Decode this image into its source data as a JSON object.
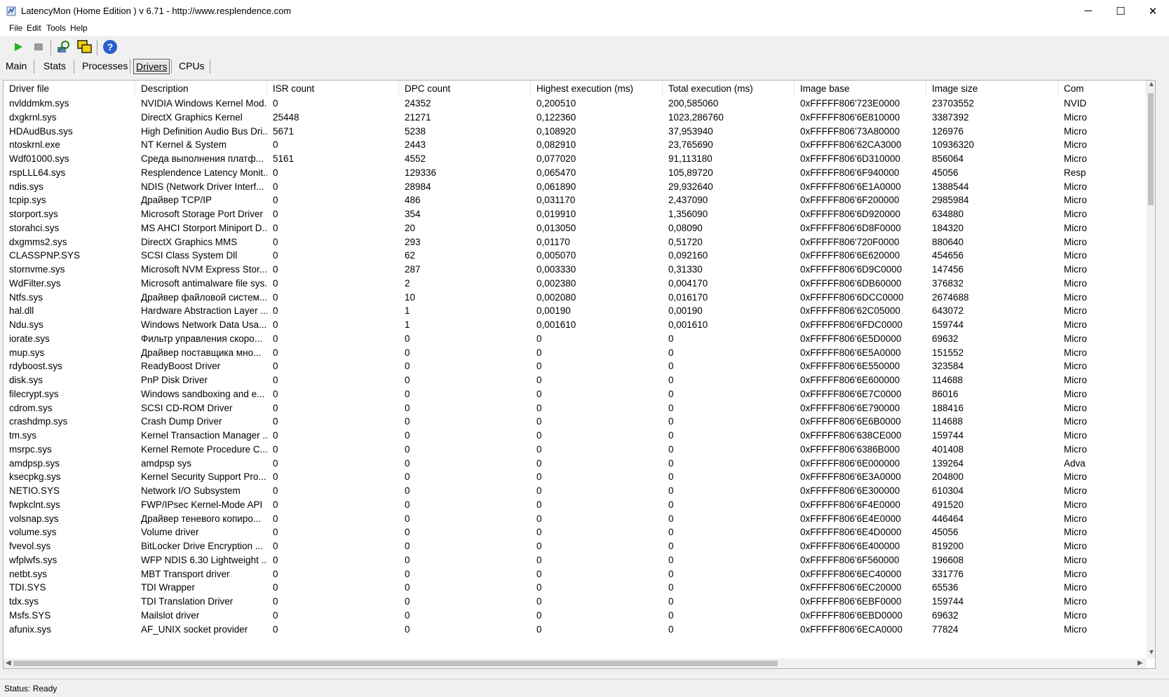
{
  "window": {
    "title": "LatencyMon  (Home Edition )  v 6.71 - http://www.resplendence.com",
    "minimize_glyph": "─",
    "maximize_glyph": "☐",
    "close_glyph": "✕"
  },
  "menu": [
    "File",
    "Edit",
    "Tools",
    "Help"
  ],
  "toolbar": {
    "buttons": [
      "play-icon",
      "stop-icon",
      "search-icon",
      "windows-icon",
      "help-icon"
    ]
  },
  "tabs": [
    {
      "label": "Main"
    },
    {
      "label": "Stats"
    },
    {
      "label": "Processes"
    },
    {
      "label": "Drivers",
      "active": true
    },
    {
      "label": "CPUs"
    }
  ],
  "table": {
    "columns": [
      "Driver file",
      "Description",
      "ISR count",
      "DPC count",
      "Highest execution (ms)",
      "Total execution (ms)",
      "Image base",
      "Image size",
      "Com"
    ],
    "rows": [
      [
        "nvlddmkm.sys",
        "NVIDIA Windows Kernel Mod...",
        "0",
        "24352",
        "0,200510",
        "200,585060",
        "0xFFFFF806'723E0000",
        "23703552",
        "NVID"
      ],
      [
        "dxgkrnl.sys",
        "DirectX Graphics Kernel",
        "25448",
        "21271",
        "0,122360",
        "1023,286760",
        "0xFFFFF806'6E810000",
        "3387392",
        "Micro"
      ],
      [
        "HDAudBus.sys",
        "High Definition Audio Bus Dri...",
        "5671",
        "5238",
        "0,108920",
        "37,953940",
        "0xFFFFF806'73A80000",
        "126976",
        "Micro"
      ],
      [
        "ntoskrnl.exe",
        "NT Kernel & System",
        "0",
        "2443",
        "0,082910",
        "23,765690",
        "0xFFFFF806'62CA3000",
        "10936320",
        "Micro"
      ],
      [
        "Wdf01000.sys",
        "Среда выполнения платф...",
        "5161",
        "4552",
        "0,077020",
        "91,113180",
        "0xFFFFF806'6D310000",
        "856064",
        "Micro"
      ],
      [
        "rspLLL64.sys",
        "Resplendence Latency Monit...",
        "0",
        "129336",
        "0,065470",
        "105,89720",
        "0xFFFFF806'6F940000",
        "45056",
        "Resp"
      ],
      [
        "ndis.sys",
        "NDIS (Network Driver Interf...",
        "0",
        "28984",
        "0,061890",
        "29,932640",
        "0xFFFFF806'6E1A0000",
        "1388544",
        "Micro"
      ],
      [
        "tcpip.sys",
        "Драйвер TCP/IP",
        "0",
        "486",
        "0,031170",
        "2,437090",
        "0xFFFFF806'6F200000",
        "2985984",
        "Micro"
      ],
      [
        "storport.sys",
        "Microsoft Storage Port Driver",
        "0",
        "354",
        "0,019910",
        "1,356090",
        "0xFFFFF806'6D920000",
        "634880",
        "Micro"
      ],
      [
        "storahci.sys",
        "MS AHCI Storport Miniport D...",
        "0",
        "20",
        "0,013050",
        "0,08090",
        "0xFFFFF806'6D8F0000",
        "184320",
        "Micro"
      ],
      [
        "dxgmms2.sys",
        "DirectX Graphics MMS",
        "0",
        "293",
        "0,01170",
        "0,51720",
        "0xFFFFF806'720F0000",
        "880640",
        "Micro"
      ],
      [
        "CLASSPNP.SYS",
        "SCSI Class System Dll",
        "0",
        "62",
        "0,005070",
        "0,092160",
        "0xFFFFF806'6E620000",
        "454656",
        "Micro"
      ],
      [
        "stornvme.sys",
        "Microsoft NVM Express Stor...",
        "0",
        "287",
        "0,003330",
        "0,31330",
        "0xFFFFF806'6D9C0000",
        "147456",
        "Micro"
      ],
      [
        "WdFilter.sys",
        "Microsoft antimalware file sys...",
        "0",
        "2",
        "0,002380",
        "0,004170",
        "0xFFFFF806'6DB60000",
        "376832",
        "Micro"
      ],
      [
        "Ntfs.sys",
        "Драйвер файловой систем...",
        "0",
        "10",
        "0,002080",
        "0,016170",
        "0xFFFFF806'6DCC0000",
        "2674688",
        "Micro"
      ],
      [
        "hal.dll",
        "Hardware Abstraction Layer ...",
        "0",
        "1",
        "0,00190",
        "0,00190",
        "0xFFFFF806'62C05000",
        "643072",
        "Micro"
      ],
      [
        "Ndu.sys",
        "Windows Network Data Usa...",
        "0",
        "1",
        "0,001610",
        "0,001610",
        "0xFFFFF806'6FDC0000",
        "159744",
        "Micro"
      ],
      [
        "iorate.sys",
        "Фильтр управления скоро...",
        "0",
        "0",
        "0",
        "0",
        "0xFFFFF806'6E5D0000",
        "69632",
        "Micro"
      ],
      [
        "mup.sys",
        "Драйвер поставщика мно...",
        "0",
        "0",
        "0",
        "0",
        "0xFFFFF806'6E5A0000",
        "151552",
        "Micro"
      ],
      [
        "rdyboost.sys",
        "ReadyBoost Driver",
        "0",
        "0",
        "0",
        "0",
        "0xFFFFF806'6E550000",
        "323584",
        "Micro"
      ],
      [
        "disk.sys",
        "PnP Disk Driver",
        "0",
        "0",
        "0",
        "0",
        "0xFFFFF806'6E600000",
        "114688",
        "Micro"
      ],
      [
        "filecrypt.sys",
        "Windows sandboxing and e...",
        "0",
        "0",
        "0",
        "0",
        "0xFFFFF806'6E7C0000",
        "86016",
        "Micro"
      ],
      [
        "cdrom.sys",
        "SCSI CD-ROM Driver",
        "0",
        "0",
        "0",
        "0",
        "0xFFFFF806'6E790000",
        "188416",
        "Micro"
      ],
      [
        "crashdmp.sys",
        "Crash Dump Driver",
        "0",
        "0",
        "0",
        "0",
        "0xFFFFF806'6E6B0000",
        "114688",
        "Micro"
      ],
      [
        "tm.sys",
        "Kernel Transaction Manager ...",
        "0",
        "0",
        "0",
        "0",
        "0xFFFFF806'638CE000",
        "159744",
        "Micro"
      ],
      [
        "msrpc.sys",
        "Kernel Remote Procedure C...",
        "0",
        "0",
        "0",
        "0",
        "0xFFFFF806'6386B000",
        "401408",
        "Micro"
      ],
      [
        "amdpsp.sys",
        "amdpsp sys",
        "0",
        "0",
        "0",
        "0",
        "0xFFFFF806'6E000000",
        "139264",
        "Adva"
      ],
      [
        "ksecpkg.sys",
        "Kernel Security Support Pro...",
        "0",
        "0",
        "0",
        "0",
        "0xFFFFF806'6E3A0000",
        "204800",
        "Micro"
      ],
      [
        "NETIO.SYS",
        "Network I/O Subsystem",
        "0",
        "0",
        "0",
        "0",
        "0xFFFFF806'6E300000",
        "610304",
        "Micro"
      ],
      [
        "fwpkclnt.sys",
        "FWP/IPsec Kernel-Mode API",
        "0",
        "0",
        "0",
        "0",
        "0xFFFFF806'6F4E0000",
        "491520",
        "Micro"
      ],
      [
        "volsnap.sys",
        "Драйвер теневого копиро...",
        "0",
        "0",
        "0",
        "0",
        "0xFFFFF806'6E4E0000",
        "446464",
        "Micro"
      ],
      [
        "volume.sys",
        "Volume driver",
        "0",
        "0",
        "0",
        "0",
        "0xFFFFF806'6E4D0000",
        "45056",
        "Micro"
      ],
      [
        "fvevol.sys",
        "BitLocker Drive Encryption ...",
        "0",
        "0",
        "0",
        "0",
        "0xFFFFF806'6E400000",
        "819200",
        "Micro"
      ],
      [
        "wfplwfs.sys",
        "WFP NDIS 6.30 Lightweight ...",
        "0",
        "0",
        "0",
        "0",
        "0xFFFFF806'6F560000",
        "196608",
        "Micro"
      ],
      [
        "netbt.sys",
        "MBT Transport driver",
        "0",
        "0",
        "0",
        "0",
        "0xFFFFF806'6EC40000",
        "331776",
        "Micro"
      ],
      [
        "TDI.SYS",
        "TDI Wrapper",
        "0",
        "0",
        "0",
        "0",
        "0xFFFFF806'6EC20000",
        "65536",
        "Micro"
      ],
      [
        "tdx.sys",
        "TDI Translation Driver",
        "0",
        "0",
        "0",
        "0",
        "0xFFFFF806'6EBF0000",
        "159744",
        "Micro"
      ],
      [
        "Msfs.SYS",
        "Mailslot driver",
        "0",
        "0",
        "0",
        "0",
        "0xFFFFF806'6EBD0000",
        "69632",
        "Micro"
      ],
      [
        "afunix.sys",
        "AF_UNIX socket provider",
        "0",
        "0",
        "0",
        "0",
        "0xFFFFF806'6ECA0000",
        "77824",
        "Micro"
      ]
    ]
  },
  "status": {
    "text": "Status: Ready"
  }
}
